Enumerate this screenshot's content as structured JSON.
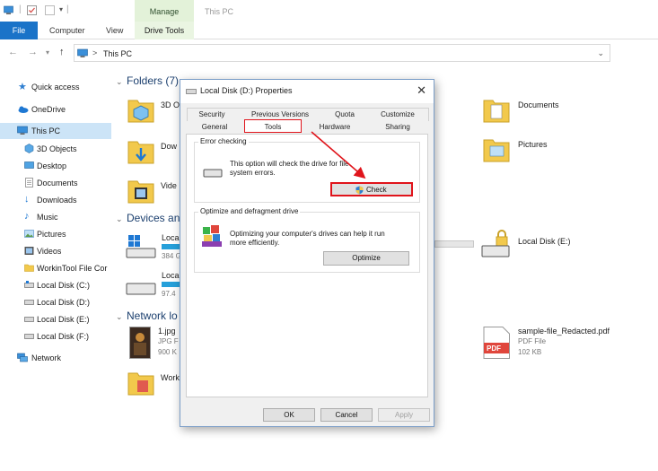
{
  "window": {
    "title": "This PC",
    "context_tab": "Manage"
  },
  "ribbon": {
    "tabs": [
      {
        "label": "File"
      },
      {
        "label": "Computer"
      },
      {
        "label": "View"
      },
      {
        "label": "Drive Tools"
      }
    ]
  },
  "address": {
    "path": "This PC",
    "separator": ">"
  },
  "sidebar": {
    "items": [
      {
        "label": "Quick access",
        "icon": "star-icon"
      },
      {
        "label": "OneDrive",
        "icon": "cloud-icon"
      },
      {
        "label": "This PC",
        "icon": "computer-icon",
        "selected": true
      },
      {
        "label": "3D Objects",
        "icon": "cube-icon"
      },
      {
        "label": "Desktop",
        "icon": "desktop-icon"
      },
      {
        "label": "Documents",
        "icon": "document-icon"
      },
      {
        "label": "Downloads",
        "icon": "download-icon"
      },
      {
        "label": "Music",
        "icon": "music-icon"
      },
      {
        "label": "Pictures",
        "icon": "picture-icon"
      },
      {
        "label": "Videos",
        "icon": "video-icon"
      },
      {
        "label": "WorkinTool File Cor",
        "icon": "folder-icon"
      },
      {
        "label": "Local Disk (C:)",
        "icon": "drive-icon"
      },
      {
        "label": "Local Disk (D:)",
        "icon": "drive-icon"
      },
      {
        "label": "Local Disk (E:)",
        "icon": "drive-icon"
      },
      {
        "label": "Local Disk (F:)",
        "icon": "drive-icon"
      },
      {
        "label": "Network",
        "icon": "network-icon"
      }
    ]
  },
  "main": {
    "folders_title": "Folders (7)",
    "devices_title": "Devices and",
    "network_title": "Network lo",
    "folders": [
      {
        "label": "3D O"
      },
      {
        "label": "Dow"
      },
      {
        "label": "Vide"
      },
      {
        "label": "Documents"
      },
      {
        "label": "Pictures"
      }
    ],
    "devices": [
      {
        "label": "Loca",
        "sub": "384 G"
      },
      {
        "label": "Loca",
        "sub": "97.4"
      },
      {
        "label": "Local Disk (E:)"
      }
    ],
    "files": [
      {
        "name": "1.jpg",
        "type": "JPG F",
        "size": "900 K"
      },
      {
        "name": "Work"
      },
      {
        "name": "sample-file_Redacted.pdf",
        "type": "PDF File",
        "size": "102 KB",
        "badge": "PDF"
      }
    ]
  },
  "dialog": {
    "title": "Local Disk (D:) Properties",
    "close_glyph": "✕",
    "tabs_row1": [
      "Security",
      "Previous Versions",
      "Quota",
      "Customize"
    ],
    "tabs_row2": [
      "General",
      "Tools",
      "Hardware",
      "Sharing"
    ],
    "active_tab": "Tools",
    "error_checking": {
      "heading": "Error checking",
      "description_line1": "This option will check the drive for file",
      "description_line2": "system errors.",
      "button": "Check"
    },
    "optimize": {
      "heading": "Optimize and defragment drive",
      "description_line1": "Optimizing your computer's drives can help it run",
      "description_line2": "more efficiently.",
      "button": "Optimize"
    },
    "footer": {
      "ok": "OK",
      "cancel": "Cancel",
      "apply": "Apply"
    }
  },
  "colors": {
    "accent": "#1a73c8",
    "annotation_red": "#e0141b",
    "folder_yellow": "#f2c94c",
    "selection": "#cce4f7"
  }
}
